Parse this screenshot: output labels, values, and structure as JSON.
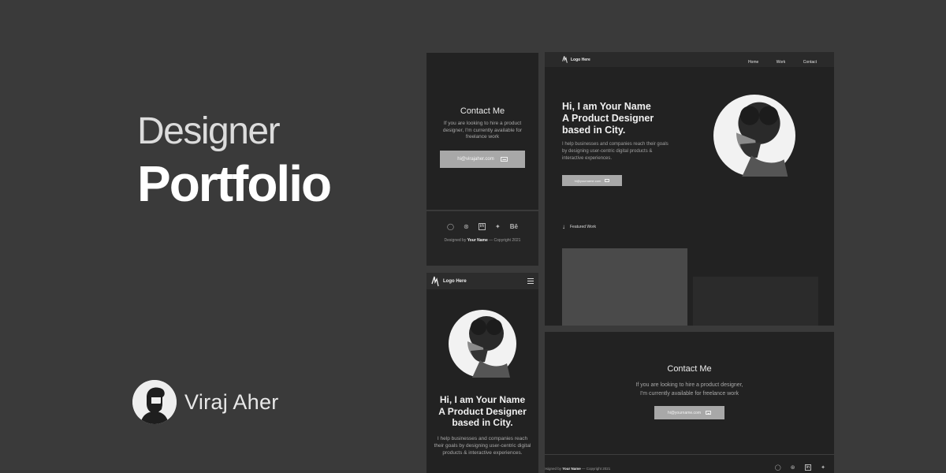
{
  "hero": {
    "line1": "Designer",
    "line2": "Portfolio"
  },
  "author": {
    "name": "Viraj Aher",
    "avatar_icon": "user-silhouette-icon"
  },
  "mobile_contact": {
    "title": "Contact Me",
    "description": "If you are looking to hire a product designer, I'm currently available for freelance work",
    "email_button": "hi@virajaher.com",
    "email_icon": "mail-icon"
  },
  "mobile_footer": {
    "social_icons": [
      "whatsapp-icon",
      "dribbble-icon",
      "linkedin-icon",
      "twitter-icon",
      "behance-icon"
    ],
    "social_glyphs": [
      "◯",
      "⊛",
      "in",
      "🐦",
      "Bē"
    ],
    "credit_prefix": "Designed by ",
    "credit_name": "Your Name",
    "credit_suffix": " — Copyright 2021"
  },
  "mobile_home": {
    "logo_text": "Logo Here",
    "heading_line1": "Hi, I am Your Name",
    "heading_line2": "A Product Designer",
    "heading_line3": "based in City.",
    "description": "I help businesses and companies reach their goals by designing user-centric digital products & interactive experiences."
  },
  "desktop_home": {
    "logo_text": "Logo Here",
    "nav": [
      "Home",
      "Work",
      "Contact"
    ],
    "heading_line1": "Hi, I am Your Name",
    "heading_line2": "A Product Designer",
    "heading_line3": "based in City.",
    "description": "I help businesses and companies reach their goals by designing user-centric digital products & interactive experiences.",
    "email_button": "hi@yourname.com",
    "featured_label": "Featured Work",
    "featured_icon": "arrow-down-icon"
  },
  "desktop_contact": {
    "title": "Contact Me",
    "description_line1": "If you are looking to hire a product designer,",
    "description_line2": "I'm currently available for freelance work",
    "email_button": "hi@yourname.com",
    "credit_prefix": "Designed by ",
    "credit_name": "Your Name",
    "credit_suffix": " — Copyright 2021"
  },
  "colors": {
    "background": "#3a3a3a",
    "panel": "#222222",
    "button": "#a8a8a8",
    "text": "#eaeaea",
    "muted_text": "#9a9a9a"
  }
}
